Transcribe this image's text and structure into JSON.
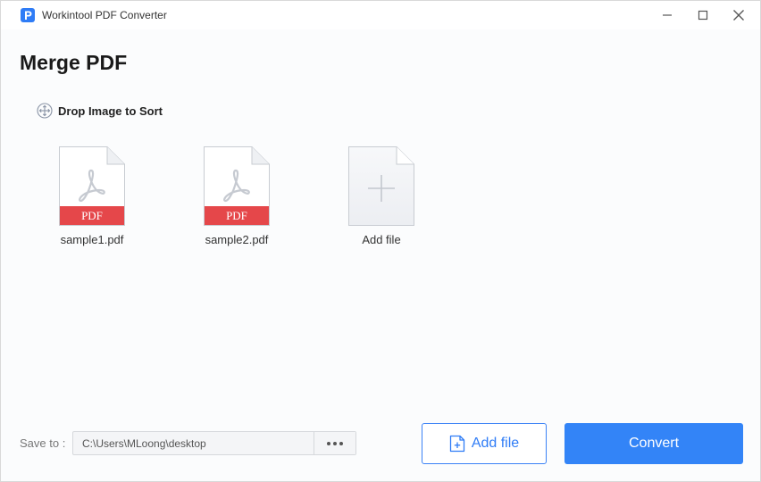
{
  "window": {
    "title": "Workintool PDF Converter"
  },
  "page": {
    "title": "Merge PDF",
    "sort_hint": "Drop Image to Sort"
  },
  "files": [
    {
      "name": "sample1.pdf",
      "badge": "PDF"
    },
    {
      "name": "sample2.pdf",
      "badge": "PDF"
    }
  ],
  "add_tile": {
    "label": "Add file"
  },
  "footer": {
    "save_label": "Save to :",
    "save_path": "C:\\Users\\MLoong\\desktop",
    "add_button_label": "Add file",
    "convert_button_label": "Convert"
  },
  "colors": {
    "accent": "#3384f7",
    "pdf_red": "#e5474a",
    "background": "#fbfcfd"
  },
  "icons": {
    "app": "app-logo-icon",
    "minimize": "minimize-icon",
    "maximize": "maximize-icon",
    "close": "close-icon",
    "sort": "move-arrows-icon",
    "pdf": "acrobat-icon",
    "add": "plus-icon",
    "browse": "more-dots-icon",
    "add_file": "file-plus-icon"
  }
}
